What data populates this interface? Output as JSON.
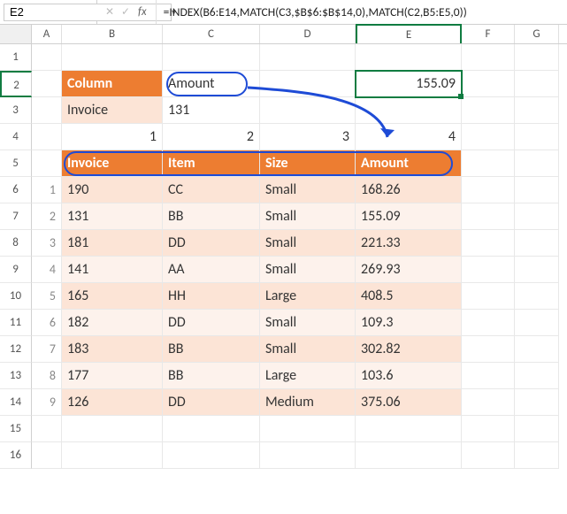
{
  "nameBox": "E2",
  "formula": "=INDEX(B6:E14,MATCH(C3,$B$6:$B$14,0),MATCH(C2,B5:E5,0))",
  "columns": [
    "A",
    "B",
    "C",
    "D",
    "E",
    "F",
    "G"
  ],
  "lookup": {
    "columnLabel": "Column",
    "columnValue": "Amount",
    "invoiceLabel": "Invoice",
    "invoiceValue": "131",
    "result": "155.09"
  },
  "helperNums": [
    "1",
    "2",
    "3",
    "4"
  ],
  "headers": {
    "B": "Invoice",
    "C": "Item",
    "D": "Size",
    "E": "Amount"
  },
  "table": [
    {
      "n": "1",
      "invoice": "190",
      "item": "CC",
      "size": "Small",
      "amount": "168.26"
    },
    {
      "n": "2",
      "invoice": "131",
      "item": "BB",
      "size": "Small",
      "amount": "155.09"
    },
    {
      "n": "3",
      "invoice": "181",
      "item": "DD",
      "size": "Small",
      "amount": "221.33"
    },
    {
      "n": "4",
      "invoice": "141",
      "item": "AA",
      "size": "Small",
      "amount": "269.93"
    },
    {
      "n": "5",
      "invoice": "165",
      "item": "HH",
      "size": "Large",
      "amount": "408.5"
    },
    {
      "n": "6",
      "invoice": "182",
      "item": "DD",
      "size": "Small",
      "amount": "109.3"
    },
    {
      "n": "7",
      "invoice": "183",
      "item": "BB",
      "size": "Small",
      "amount": "302.82"
    },
    {
      "n": "8",
      "invoice": "177",
      "item": "BB",
      "size": "Large",
      "amount": "103.6"
    },
    {
      "n": "9",
      "invoice": "126",
      "item": "DD",
      "size": "Medium",
      "amount": "375.06"
    }
  ],
  "rowNumbers": [
    "1",
    "2",
    "3",
    "4",
    "5",
    "6",
    "7",
    "8",
    "9",
    "10",
    "11",
    "12",
    "13",
    "14",
    "15",
    "16"
  ],
  "fxLabel": "fx"
}
